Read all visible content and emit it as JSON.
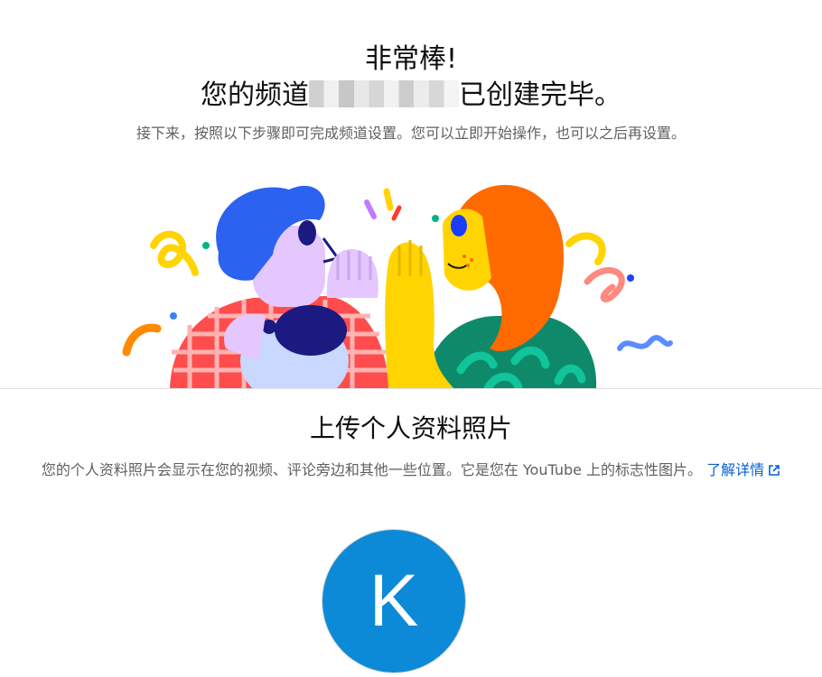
{
  "header": {
    "title_line1": "非常棒!",
    "title_line2_prefix": "您的频道",
    "title_line2_suffix": "已创建完毕。",
    "subtitle": "接下来，按照以下步骤即可完成频道设置。您可以立即开始操作，也可以之后再设置。"
  },
  "profile_photo": {
    "title": "上传个人资料照片",
    "description": "您的个人资料照片会显示在您的视频、评论旁边和其他一些位置。它是您在 YouTube 上的标志性图片。",
    "learn_more": "了解详情",
    "avatar_letter": "K",
    "avatar_color": "#0d8ad7"
  },
  "colors": {
    "link": "#065fd4",
    "muted_text": "#606060"
  }
}
